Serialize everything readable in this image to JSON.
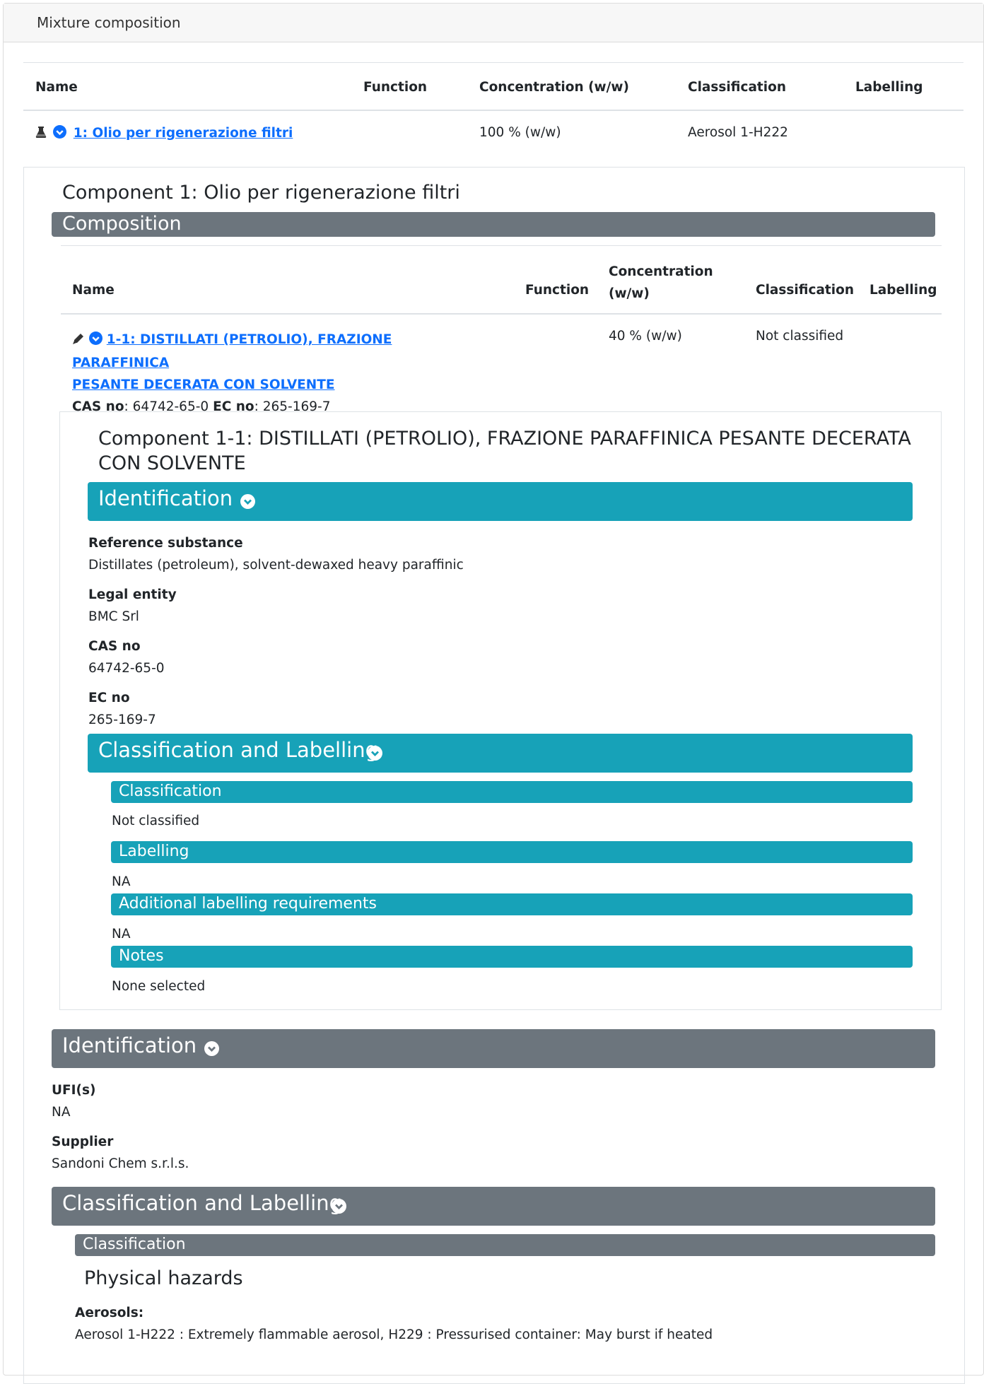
{
  "card": {
    "title": "Mixture composition"
  },
  "mixture_table": {
    "headers": [
      "Name",
      "Function",
      "Concentration (w/w)",
      "Classification",
      "Labelling"
    ],
    "row": {
      "name": "1: Olio per rigenerazione filtri",
      "function": "",
      "concentration": "100 % (w/w)",
      "classification": "Aerosol 1-H222",
      "labelling": ""
    }
  },
  "component1": {
    "title": "Component 1: Olio per rigenerazione filtri",
    "composition_label": "Composition",
    "table": {
      "headers": [
        "Name",
        "Function",
        "Concentration (w/w)",
        "Classification",
        "Labelling"
      ],
      "row": {
        "name_line1": "1-1: DISTILLATI (PETROLIO), FRAZIONE PARAFFINICA",
        "name_line2": "PESANTE DECERATA CON SOLVENTE",
        "cas_label": "CAS no",
        "cas_value": ": 64742-65-0",
        "ec_label": "EC no",
        "ec_value": ": 265-169-7",
        "function": "",
        "concentration": "40 % (w/w)",
        "classification": "Not classified",
        "labelling": ""
      }
    },
    "sub": {
      "title_line1": "Component 1-1: DISTILLATI (PETROLIO), FRAZIONE PARAFFINICA PESANTE DECERATA",
      "title_line2": "CON SOLVENTE",
      "identification_label": "Identification",
      "fields": [
        {
          "label": "Reference substance",
          "value": "Distillates (petroleum), solvent-dewaxed heavy paraffinic"
        },
        {
          "label": "Legal entity",
          "value": "BMC Srl"
        },
        {
          "label": "CAS no",
          "value": "64742-65-0"
        },
        {
          "label": "EC no",
          "value": "265-169-7"
        }
      ],
      "cl_label": "Classification and Labelling",
      "classification_label": "Classification",
      "classification_value": "Not classified",
      "labelling_label": "Labelling",
      "labelling_value": "NA",
      "additional_label": "Additional labelling requirements",
      "additional_value": "NA",
      "notes_label": "Notes",
      "notes_value": "None selected"
    },
    "identification_label": "Identification",
    "ufi_label": "UFI(s)",
    "ufi_value": "NA",
    "supplier_label": "Supplier",
    "supplier_value": "Sandoni Chem s.r.l.s.",
    "cl_label": "Classification and Labelling",
    "classification_label": "Classification",
    "physical_hazards": "Physical hazards",
    "aerosols_label": "Aerosols:",
    "aerosols_value": "Aerosol 1-H222 : Extremely flammable aerosol, H229 : Pressurised container: May burst if heated"
  },
  "colors": {
    "teal": "#17a2b8",
    "gray": "#6c757d",
    "link": "#0d6efd"
  }
}
